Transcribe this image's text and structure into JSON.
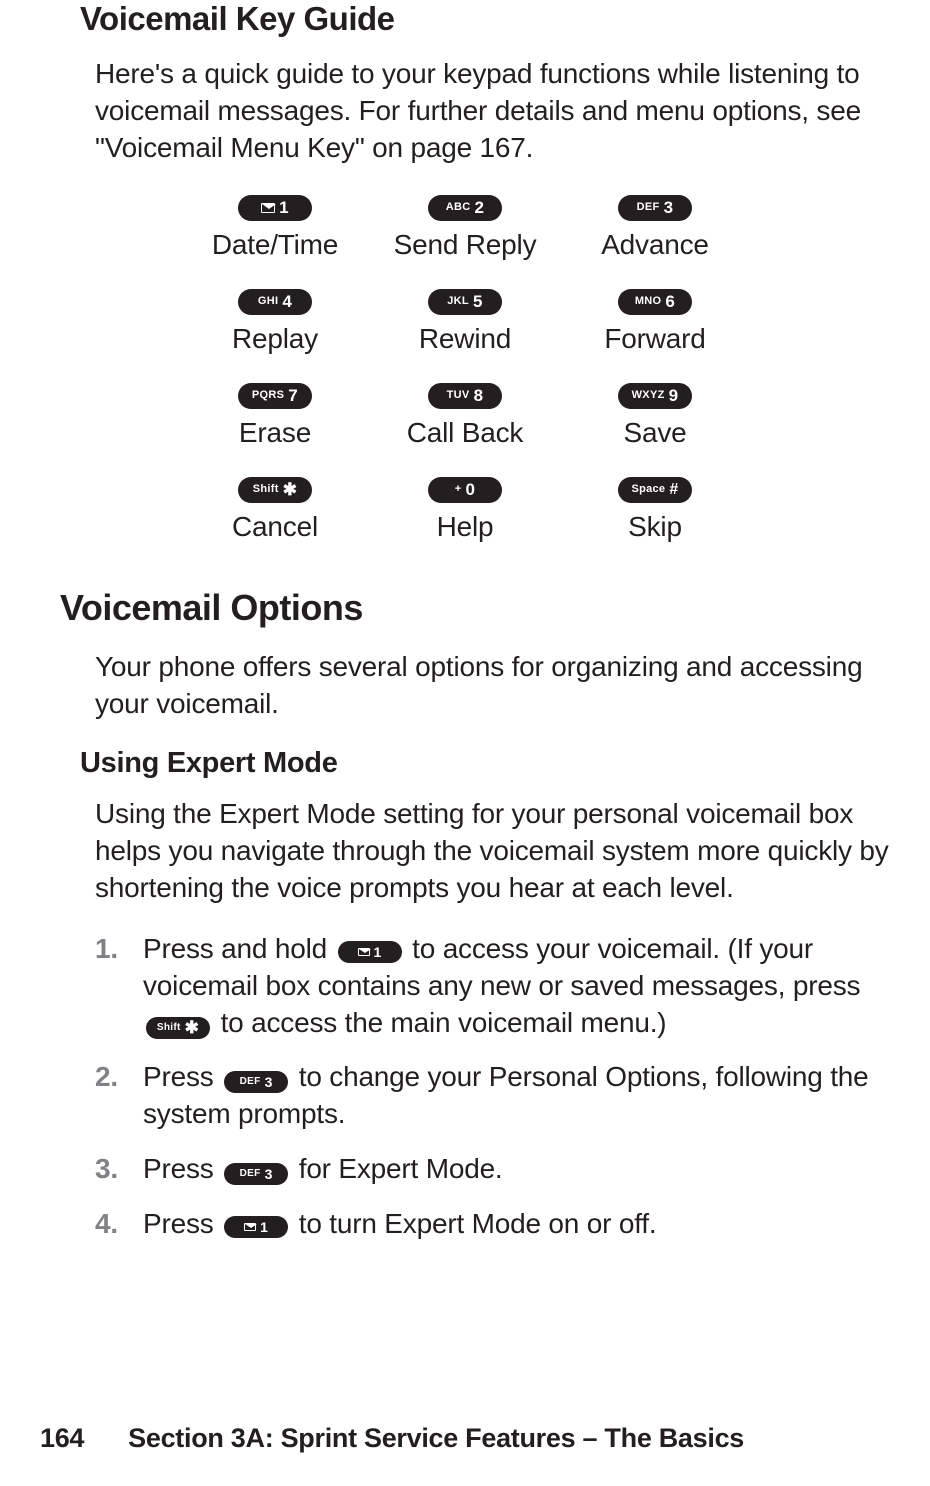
{
  "headings": {
    "keyGuide": "Voicemail Key Guide",
    "options": "Voicemail Options",
    "expertMode": "Using Expert Mode"
  },
  "paragraphs": {
    "keyGuideIntro": "Here's a quick guide to your keypad functions while listening to voicemail messages. For further details and menu options, see \"Voicemail Menu Key\" on page 167.",
    "optionsIntro": "Your phone offers several options for organizing and accessing your voicemail.",
    "expertModeIntro": "Using the Expert Mode setting for your personal voicemail box helps you navigate through the voicemail system more quickly by shortening the voice prompts you hear at each level."
  },
  "keys": {
    "k1": {
      "left_type": "icon",
      "left": "mail",
      "num": "1",
      "label": "Date/Time"
    },
    "k2": {
      "left_type": "text",
      "left": "ABC",
      "num": "2",
      "label": "Send Reply"
    },
    "k3": {
      "left_type": "text",
      "left": "DEF",
      "num": "3",
      "label": "Advance"
    },
    "k4": {
      "left_type": "text",
      "left": "GHI",
      "num": "4",
      "label": "Replay"
    },
    "k5": {
      "left_type": "text",
      "left": "JKL",
      "num": "5",
      "label": "Rewind"
    },
    "k6": {
      "left_type": "text",
      "left": "MNO",
      "num": "6",
      "label": "Forward"
    },
    "k7": {
      "left_type": "text",
      "left": "PQRS",
      "num": "7",
      "label": "Erase"
    },
    "k8": {
      "left_type": "text",
      "left": "TUV",
      "num": "8",
      "label": "Call Back"
    },
    "k9": {
      "left_type": "text",
      "left": "WXYZ",
      "num": "9",
      "label": "Save"
    },
    "kstar": {
      "left_type": "text",
      "left": "Shift",
      "num_type": "star",
      "num": "✱",
      "label": "Cancel"
    },
    "k0": {
      "left_type": "text",
      "left": "+",
      "num": "0",
      "label": "Help"
    },
    "khash": {
      "left_type": "text",
      "left": "Space",
      "num_type": "hash",
      "num": "#",
      "label": "Skip"
    }
  },
  "steps": {
    "s1": {
      "num": "1.",
      "before": "Press and hold ",
      "key1": "k1",
      "mid": " to access your voicemail. (If your voicemail box contains any new or saved messages, press ",
      "key2": "kstar",
      "after": " to access the main voicemail menu.)"
    },
    "s2": {
      "num": "2.",
      "before": "Press ",
      "key1": "k3",
      "after": " to change your Personal Options, following the system prompts."
    },
    "s3": {
      "num": "3.",
      "before": "Press ",
      "key1": "k3",
      "after": " for Expert Mode."
    },
    "s4": {
      "num": "4.",
      "before": "Press ",
      "key1": "k1",
      "after": " to turn Expert Mode on or off."
    }
  },
  "footer": {
    "page": "164",
    "section": "Section 3A: Sprint Service Features – The Basics"
  }
}
